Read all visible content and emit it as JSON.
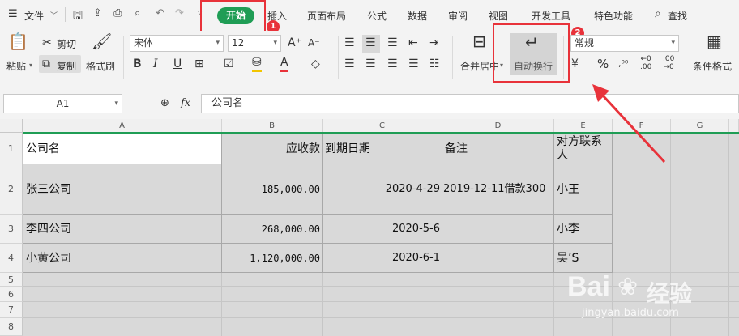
{
  "menubar": {
    "file": "文件",
    "tabs": [
      "开始",
      "插入",
      "页面布局",
      "公式",
      "数据",
      "审阅",
      "视图",
      "开发工具",
      "特色功能"
    ],
    "search": "查找"
  },
  "annotations": {
    "step1": "1",
    "step2": "2"
  },
  "ribbon": {
    "paste": "粘贴",
    "cut": "剪切",
    "copy": "复制",
    "format_painter": "格式刷",
    "font_name": "宋体",
    "font_size": "12",
    "merge_center": "合并居中",
    "wrap_text": "自动换行",
    "number_format": "常规",
    "percent": "%",
    "cond_format": "条件格式",
    "bold": "B",
    "italic": "I",
    "underline": "U",
    "font_color": "A"
  },
  "formula_bar": {
    "cell_ref": "A1",
    "fx": "fx",
    "value": "公司名"
  },
  "columns": [
    "A",
    "B",
    "C",
    "D",
    "E",
    "F",
    "G"
  ],
  "rows": [
    "1",
    "2",
    "3",
    "4",
    "5",
    "6",
    "7",
    "8"
  ],
  "table": [
    {
      "a": "公司名",
      "b": "应收款",
      "c": "到期日期",
      "d": "备注",
      "e1": "对方联系",
      "e2": "人"
    },
    {
      "a": "张三公司",
      "b": "185,000.00",
      "c": "2020-4-29",
      "d": "2019-12-11借款300",
      "e1": "小王",
      "e2": ""
    },
    {
      "a": "李四公司",
      "b": "268,000.00",
      "c": "2020-5-6",
      "d": "",
      "e1": "小李",
      "e2": ""
    },
    {
      "a": "小黄公司",
      "b": "1,120,000.00",
      "c": "2020-6-1",
      "d": "",
      "e1": "吴’S",
      "e2": ""
    }
  ],
  "watermark": {
    "brand": "Bai",
    "brand2": "经验",
    "url": "jingyan.baidu.com"
  },
  "colors": {
    "accent": "#1f9d55",
    "highlight": "#e8323a",
    "selection": "#d9d9d9"
  }
}
